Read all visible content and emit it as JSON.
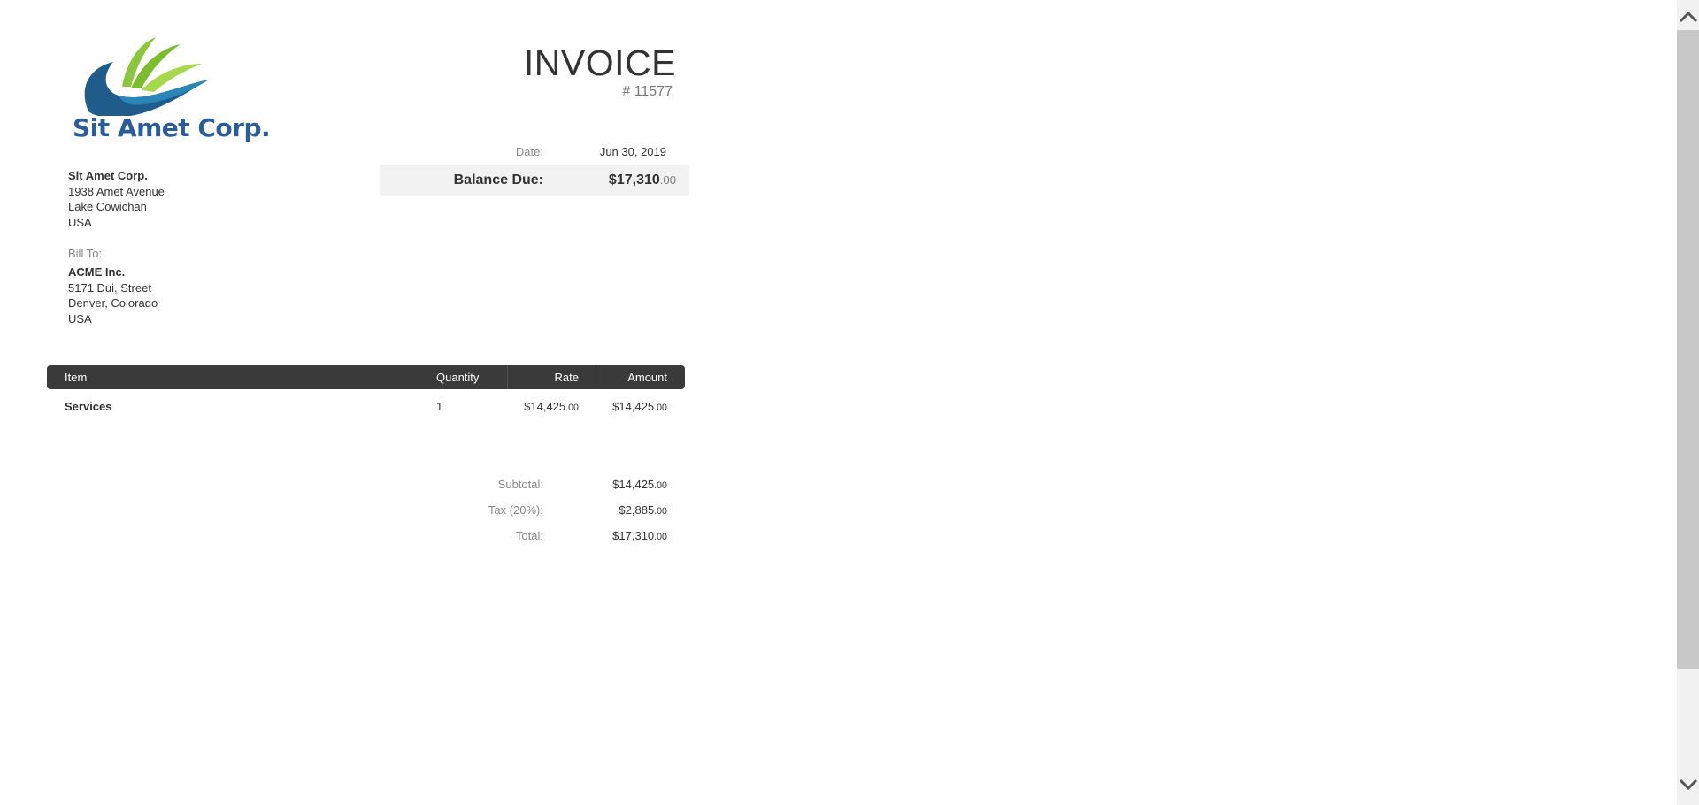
{
  "company": {
    "logo_text": "Sit Amet Corp.",
    "name": "Sit Amet Corp.",
    "address_lines": [
      "1938 Amet Avenue",
      "Lake Cowichan",
      "USA"
    ]
  },
  "invoice": {
    "title": "INVOICE",
    "number": "# 11577",
    "date_label": "Date:",
    "date_value": "Jun 30, 2019",
    "balance_label": "Balance Due:",
    "balance_main": "$17,310",
    "balance_cents": ".00"
  },
  "bill_to": {
    "label": "Bill To:",
    "name": "ACME Inc.",
    "address_lines": [
      "5171 Dui, Street",
      "Denver, Colorado",
      "USA"
    ]
  },
  "table": {
    "headers": {
      "item": "Item",
      "quantity": "Quantity",
      "rate": "Rate",
      "amount": "Amount"
    },
    "rows": [
      {
        "item": "Services",
        "quantity": "1",
        "rate_main": "$14,425",
        "rate_cents": ".00",
        "amount_main": "$14,425",
        "amount_cents": ".00"
      }
    ]
  },
  "totals": {
    "subtotal_label": "Subtotal:",
    "subtotal_main": "$14,425",
    "subtotal_cents": ".00",
    "tax_label": "Tax (20%):",
    "tax_main": "$2,885",
    "tax_cents": ".00",
    "total_label": "Total:",
    "total_main": "$17,310",
    "total_cents": ".00"
  },
  "colors": {
    "logo_blue": "#2a5d9a",
    "logo_green": "#7dbb2f",
    "table_header": "#3a3a3a",
    "balance_bg": "#f2f2f2"
  },
  "icons": {
    "scroll_up": "chevron-up-icon",
    "scroll_down": "chevron-down-icon"
  }
}
